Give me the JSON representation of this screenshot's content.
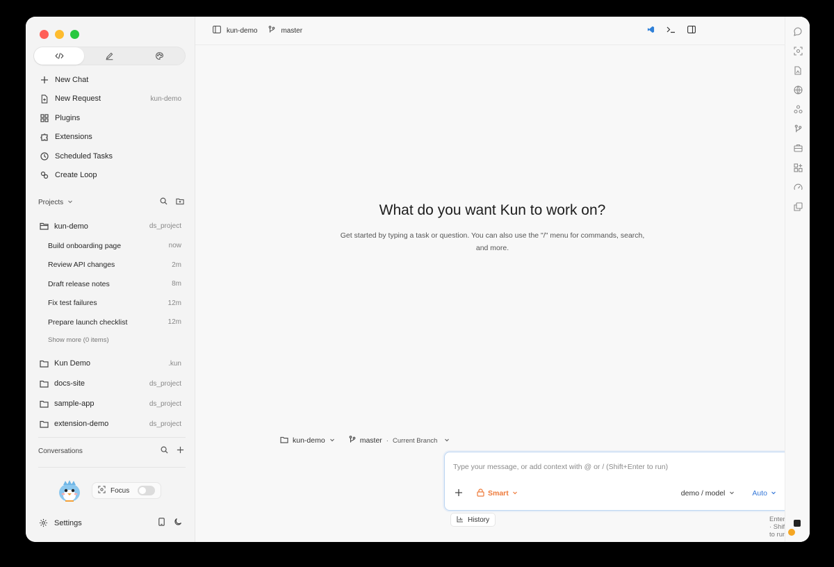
{
  "sidebar": {
    "nav": [
      {
        "label": "New Chat",
        "icon": "plus-icon",
        "meta": ""
      },
      {
        "label": "New Request",
        "icon": "file-icon",
        "meta": "kun-demo"
      },
      {
        "label": "Plugins",
        "icon": "grid-icon",
        "meta": ""
      },
      {
        "label": "Extensions",
        "icon": "puzzle-icon",
        "meta": ""
      },
      {
        "label": "Scheduled Tasks",
        "icon": "clock-icon",
        "meta": ""
      },
      {
        "label": "Create Loop",
        "icon": "loop-icon",
        "meta": ""
      }
    ],
    "projects_label": "Projects",
    "active_project": {
      "name": "kun-demo",
      "meta": "ds_project"
    },
    "threads": [
      {
        "title": "Build onboarding page",
        "time": "now"
      },
      {
        "title": "Review API changes",
        "time": "2m"
      },
      {
        "title": "Draft release notes",
        "time": "8m"
      },
      {
        "title": "Fix test failures",
        "time": "12m"
      },
      {
        "title": "Prepare launch checklist",
        "time": "12m"
      }
    ],
    "show_more": "Show more (0 items)",
    "other_projects": [
      {
        "name": "Kun Demo",
        "meta": ".kun"
      },
      {
        "name": "docs-site",
        "meta": "ds_project"
      },
      {
        "name": "sample-app",
        "meta": "ds_project"
      },
      {
        "name": "extension-demo",
        "meta": "ds_project"
      }
    ],
    "conversations_label": "Conversations",
    "focus_label": "Focus",
    "focus_on": false,
    "settings_label": "Settings"
  },
  "topbar": {
    "project": "kun-demo",
    "branch": "master"
  },
  "main": {
    "title": "What do you want Kun to work on?",
    "subtitle": "Get started by typing a task or question. You can also use the \"/\" menu for commands, search, and more."
  },
  "context": {
    "project": "kun-demo",
    "branch": "master",
    "branch_note": "Current Branch"
  },
  "composer": {
    "placeholder": "Type your message, or add context with @ or /     (Shift+Enter to run)",
    "smart_label": "Smart",
    "model_label": "demo / model",
    "auto_label": "Auto"
  },
  "history_label": "History",
  "hint": "Enter to send · Shift+Enter to run",
  "colors": {
    "accent_blue": "#3477d8",
    "smart_orange": "#ee7a3a",
    "bolt_yellow": "#f1a424"
  }
}
